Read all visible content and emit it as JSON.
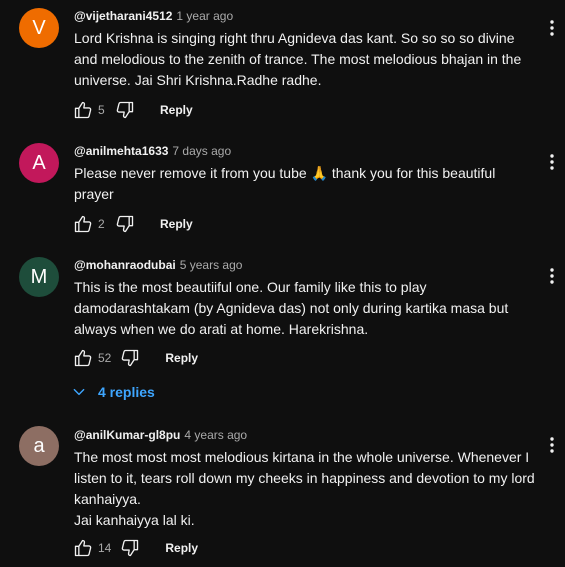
{
  "comments": [
    {
      "avatar_letter": "V",
      "avatar_color": "#ef6c00",
      "author": "@vijetharani4512",
      "time": "1 year ago",
      "lines": [
        "Lord Krishna is singing right thru Agnideva das  kant.  So  so so so divine and melodious to the zenith of trance. The most melodious bhajan in the universe. Jai Shri Krishna.Radhe radhe."
      ],
      "likes": "5",
      "reply_label": "Reply"
    },
    {
      "avatar_letter": "A",
      "avatar_color": "#c2185b",
      "author": "@anilmehta1633",
      "time": "7 days ago",
      "lines": [
        "Please never remove it from you tube 🙏 thank you for this beautiful prayer"
      ],
      "likes": "2",
      "reply_label": "Reply"
    },
    {
      "avatar_letter": "M",
      "avatar_color": "#1e4d3b",
      "author": "@mohanraodubai",
      "time": "5 years ago",
      "lines": [
        "This is the most beautiiful one.  Our family like this to play damodarashtakam (by Agnideva das) not only during kartika masa but always when we do arati at home. Harekrishna."
      ],
      "likes": "52",
      "reply_label": "Reply",
      "replies_label": "4 replies"
    },
    {
      "avatar_letter": "a",
      "avatar_color": "#8d6e63",
      "author": "@anilKumar-gl8pu",
      "time": "4 years ago",
      "lines": [
        "The most most most melodious kirtana in the whole universe. Whenever I listen to it,  tears roll down  my cheeks in happiness and devotion to my lord kanhaiyya.",
        "Jai kanhaiyya lal ki."
      ],
      "likes": "14",
      "reply_label": "Reply"
    }
  ]
}
